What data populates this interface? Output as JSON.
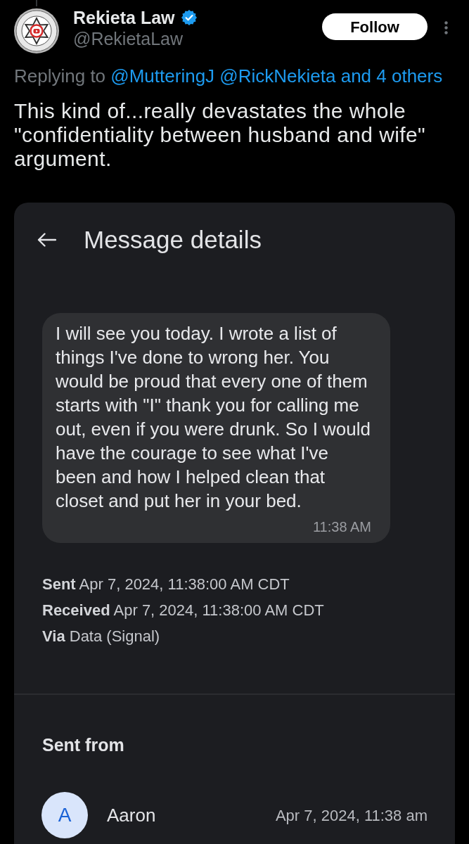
{
  "tweet": {
    "author": {
      "name": "Rekieta Law",
      "verified": true,
      "handle": "@RekietaLaw"
    },
    "follow_button": {
      "label": "Follow"
    },
    "replying_to": {
      "label": "Replying to",
      "mentions": [
        "@MutteringJ",
        "@RickNekieta"
      ],
      "others": "and 4 others"
    },
    "text": "This kind of...really devastates the whole \"confidentiality between husband and wife\" argument."
  },
  "message_details": {
    "title": "Message details",
    "message": {
      "text": "I will see you today. I wrote a list of things I've done to wrong her. You would be proud that every one of them starts with \"I\" thank you for calling me out, even if you were drunk. So I would have the courage to see what I've been and how I helped clean that closet and put her in your bed.",
      "time": "11:38 AM"
    },
    "details": [
      {
        "label": "Sent",
        "value": "Apr 7, 2024, 11:38:00 AM CDT"
      },
      {
        "label": "Received",
        "value": "Apr 7, 2024, 11:38:00 AM CDT"
      },
      {
        "label": "Via",
        "value": "Data (Signal)"
      }
    ],
    "sent_from": {
      "heading": "Sent from",
      "contacts": [
        {
          "initial": "A",
          "name": "Aaron",
          "time": "Apr 7, 2024, 11:38 am"
        }
      ]
    }
  }
}
